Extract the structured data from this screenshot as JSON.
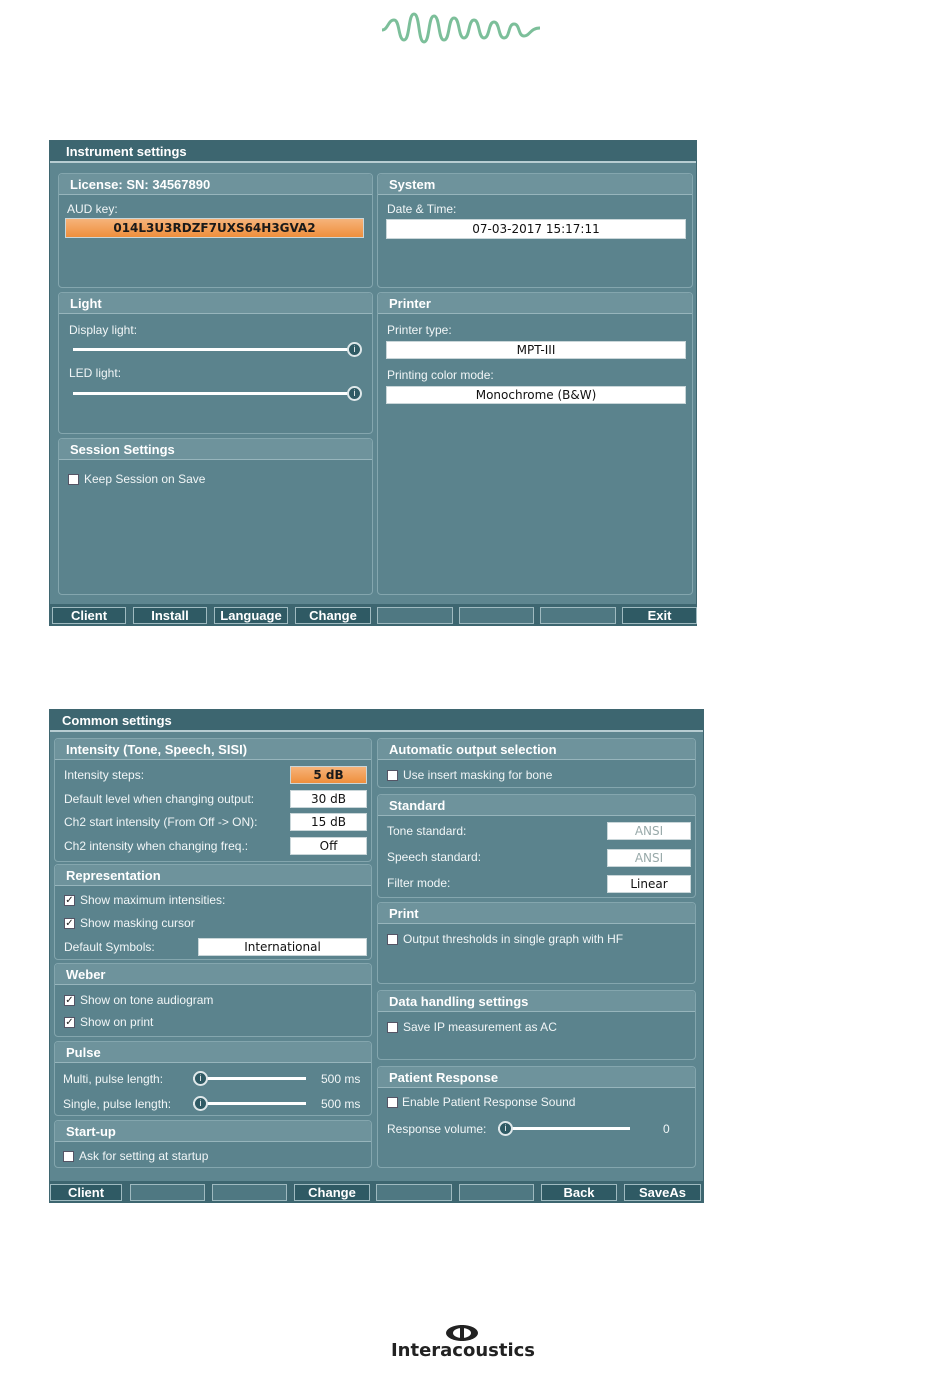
{
  "brand": {
    "name": "Interacoustics",
    "logo_color": "#7cbf9a"
  },
  "instrument": {
    "title": "Instrument settings",
    "license": {
      "header": "License: SN: 34567890",
      "aud_key_label": "AUD key:",
      "aud_key": "014L3U3RDZF7UXS64H3GVA2"
    },
    "system": {
      "header": "System",
      "datetime_label": "Date & Time:",
      "datetime": "07-03-2017 15:17:11"
    },
    "light": {
      "header": "Light",
      "display_label": "Display light:",
      "led_label": "LED light:",
      "display_level": 1.0,
      "led_level": 1.0
    },
    "printer": {
      "header": "Printer",
      "type_label": "Printer type:",
      "type": "MPT-III",
      "color_label": "Printing color mode:",
      "color": "Monochrome (B&W)"
    },
    "session": {
      "header": "Session Settings",
      "keep_label": "Keep Session on Save",
      "keep_checked": false
    },
    "buttons": [
      "Client",
      "Install",
      "Language",
      "Change",
      "",
      "",
      "",
      "Exit"
    ]
  },
  "common": {
    "title": "Common settings",
    "intensity": {
      "header": "Intensity (Tone, Speech, SISI)",
      "rows": [
        {
          "label": "Intensity steps:",
          "value": "5 dB"
        },
        {
          "label": "Default level when changing output:",
          "value": "30 dB"
        },
        {
          "label": "Ch2 start intensity (From Off -> ON):",
          "value": "15 dB"
        },
        {
          "label": "Ch2 intensity when changing freq.:",
          "value": "Off"
        }
      ]
    },
    "representation": {
      "header": "Representation",
      "max_label": "Show maximum intensities:",
      "max_checked": true,
      "mask_label": "Show masking cursor",
      "mask_checked": true,
      "symbols_label": "Default Symbols:",
      "symbols": "International"
    },
    "weber": {
      "header": "Weber",
      "tone_label": "Show on tone audiogram",
      "tone_checked": true,
      "print_label": "Show on print",
      "print_checked": true
    },
    "pulse": {
      "header": "Pulse",
      "multi_label": "Multi, pulse length:",
      "multi_value": "500 ms",
      "single_label": "Single, pulse length:",
      "single_value": "500 ms"
    },
    "startup": {
      "header": "Start-up",
      "ask_label": "Ask for setting at startup",
      "ask_checked": false
    },
    "auto_output": {
      "header": "Automatic output selection",
      "insert_label": "Use insert masking for bone",
      "insert_checked": false
    },
    "standard": {
      "header": "Standard",
      "tone_label": "Tone standard:",
      "tone": "ANSI",
      "speech_label": "Speech standard:",
      "speech": "ANSI",
      "filter_label": "Filter mode:",
      "filter": "Linear"
    },
    "print": {
      "header": "Print",
      "hf_label": "Output thresholds in single graph with HF",
      "hf_checked": false
    },
    "data": {
      "header": "Data handling settings",
      "ip_label": "Save IP measurement as AC",
      "ip_checked": false
    },
    "patient": {
      "header": "Patient Response",
      "sound_label": "Enable Patient Response Sound",
      "sound_checked": false,
      "volume_label": "Response volume:",
      "volume": "0"
    },
    "buttons": [
      "Client",
      "",
      "",
      "Change",
      "",
      "",
      "Back",
      "SaveAs"
    ]
  }
}
